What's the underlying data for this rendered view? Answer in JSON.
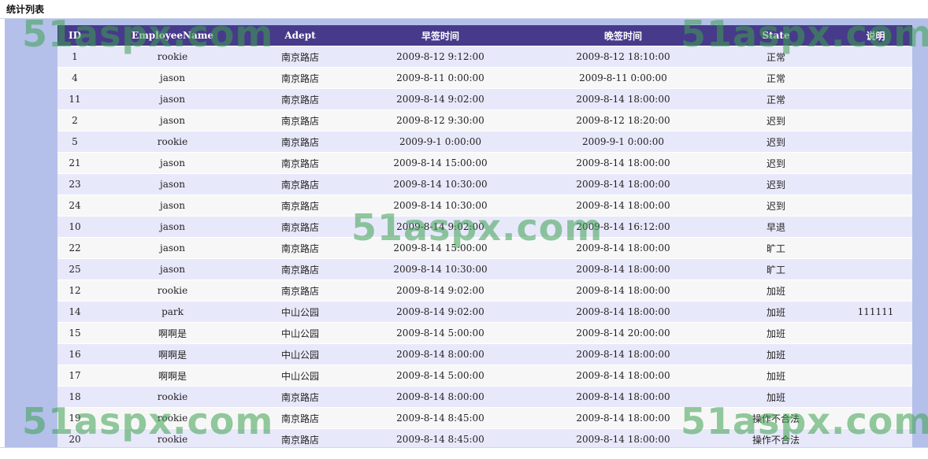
{
  "page": {
    "title": "统计列表"
  },
  "table": {
    "headers": [
      "ID",
      "EmployeeName",
      "Adept",
      "早签时间",
      "晚签时间",
      "State",
      "说明"
    ],
    "rows": [
      [
        "1",
        "rookie",
        "南京路店",
        "2009-8-12 9:12:00",
        "2009-8-12 18:10:00",
        "正常",
        ""
      ],
      [
        "4",
        "jason",
        "南京路店",
        "2009-8-11 0:00:00",
        "2009-8-11 0:00:00",
        "正常",
        ""
      ],
      [
        "11",
        "jason",
        "南京路店",
        "2009-8-14 9:02:00",
        "2009-8-14 18:00:00",
        "正常",
        ""
      ],
      [
        "2",
        "jason",
        "南京路店",
        "2009-8-12 9:30:00",
        "2009-8-12 18:20:00",
        "迟到",
        ""
      ],
      [
        "5",
        "rookie",
        "南京路店",
        "2009-9-1 0:00:00",
        "2009-9-1 0:00:00",
        "迟到",
        ""
      ],
      [
        "21",
        "jason",
        "南京路店",
        "2009-8-14 15:00:00",
        "2009-8-14 18:00:00",
        "迟到",
        ""
      ],
      [
        "23",
        "jason",
        "南京路店",
        "2009-8-14 10:30:00",
        "2009-8-14 18:00:00",
        "迟到",
        ""
      ],
      [
        "24",
        "jason",
        "南京路店",
        "2009-8-14 10:30:00",
        "2009-8-14 18:00:00",
        "迟到",
        ""
      ],
      [
        "10",
        "jason",
        "南京路店",
        "2009-8-14 9:02:00",
        "2009-8-14 16:12:00",
        "早退",
        ""
      ],
      [
        "22",
        "jason",
        "南京路店",
        "2009-8-14 15:00:00",
        "2009-8-14 18:00:00",
        "旷工",
        ""
      ],
      [
        "25",
        "jason",
        "南京路店",
        "2009-8-14 10:30:00",
        "2009-8-14 18:00:00",
        "旷工",
        ""
      ],
      [
        "12",
        "rookie",
        "南京路店",
        "2009-8-14 9:02:00",
        "2009-8-14 18:00:00",
        "加班",
        ""
      ],
      [
        "14",
        "park",
        "中山公园",
        "2009-8-14 9:02:00",
        "2009-8-14 18:00:00",
        "加班",
        "111111"
      ],
      [
        "15",
        "啊啊是",
        "中山公园",
        "2009-8-14 5:00:00",
        "2009-8-14 20:00:00",
        "加班",
        ""
      ],
      [
        "16",
        "啊啊是",
        "中山公园",
        "2009-8-14 8:00:00",
        "2009-8-14 18:00:00",
        "加班",
        ""
      ],
      [
        "17",
        "啊啊是",
        "中山公园",
        "2009-8-14 5:00:00",
        "2009-8-14 18:00:00",
        "加班",
        ""
      ],
      [
        "18",
        "rookie",
        "南京路店",
        "2009-8-14 8:00:00",
        "2009-8-14 18:00:00",
        "加班",
        ""
      ],
      [
        "19",
        "rookie",
        "南京路店",
        "2009-8-14 8:45:00",
        "2009-8-14 18:00:00",
        "操作不合法",
        ""
      ],
      [
        "20",
        "rookie",
        "南京路店",
        "2009-8-14 8:45:00",
        "2009-8-14 18:00:00",
        "操作不合法",
        ""
      ]
    ]
  },
  "watermark": {
    "text": "51aspx.com"
  },
  "colors": {
    "header_bg": "#473a8a",
    "panel_bg": "#b4c0ea",
    "row_odd": "#e8e8fb",
    "row_even": "#f7f7f7",
    "watermark": "#3ca050"
  }
}
